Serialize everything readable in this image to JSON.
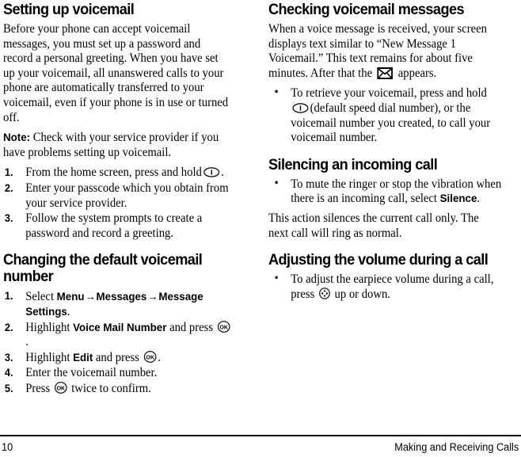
{
  "page": {
    "footer": {
      "page_number": "10",
      "running_title": "Making and Receiving Calls"
    }
  },
  "left_column": {
    "section1": {
      "heading": "Setting up voicemail",
      "intro": "Before your phone can accept voicemail messages, you must set up a password and record a personal greeting. When you have set up your voicemail, all unanswered calls to your phone are automatically transferred to your voicemail, even if your phone is in use or turned off.",
      "note_label": "Note:",
      "note_text": " Check with your service provider if you have problems setting up voicemail.",
      "steps": [
        {
          "num": "1.",
          "text_before": "From the home screen, press and hold",
          "icon": "key-1-icon",
          "text_after": "."
        },
        {
          "num": "2.",
          "text_before": "Enter your passcode which you obtain from your service provider.",
          "icon": "",
          "text_after": ""
        },
        {
          "num": "3.",
          "text_before": "Follow the system prompts to create a password and record a greeting.",
          "icon": "",
          "text_after": ""
        }
      ]
    },
    "section2": {
      "heading": "Changing the default voicemail number",
      "steps": [
        {
          "num": "1.",
          "lead": "Select ",
          "term1": "Menu",
          "arrow1": "→",
          "term2": "Messages",
          "arrow2": "→",
          "term3": "Message Settings",
          "tail": "."
        },
        {
          "num": "2.",
          "lead": "Highlight ",
          "term": "Voice Mail Number",
          "mid": " and press ",
          "icon": "ok-key-icon",
          "tail": "."
        },
        {
          "num": "3.",
          "lead": "Highlight ",
          "term": "Edit",
          "mid": " and press ",
          "icon": "ok-key-icon",
          "tail": "."
        },
        {
          "num": "4.",
          "lead": "Enter the voicemail number.",
          "term": "",
          "mid": "",
          "icon": "",
          "tail": ""
        },
        {
          "num": "5.",
          "lead": "Press ",
          "term": "",
          "mid": "",
          "icon": "ok-key-icon",
          "tail": " twice to confirm."
        }
      ]
    }
  },
  "right_column": {
    "section1": {
      "heading": "Checking voicemail messages",
      "para_part1": "When a voice message is received, your screen displays text similar to “New Message 1 Voicemail.” This text remains for about five minutes. After that the ",
      "envelope_icon": "envelope-icon",
      "para_part2": " appears.",
      "bullet": {
        "text_before": "To retrieve your voicemail, press and hold",
        "icon": "key-1-icon",
        "text_after": "(default speed dial number), or the voicemail number you created, to call your voicemail number."
      }
    },
    "section2": {
      "heading": "Silencing an incoming call",
      "bullet_before": "To mute the ringer or stop the vibration when there is an incoming call, select ",
      "bullet_term": "Silence",
      "bullet_after": ".",
      "para": "This action silences the current call only. The next call will ring as normal."
    },
    "section3": {
      "heading": "Adjusting the volume during a call",
      "bullet_before": "To adjust the earpiece volume during a call, press ",
      "icon": "navigation-key-icon",
      "bullet_after": " up or down."
    }
  },
  "colors": {
    "text": "#000000",
    "background": "#ffffff"
  }
}
